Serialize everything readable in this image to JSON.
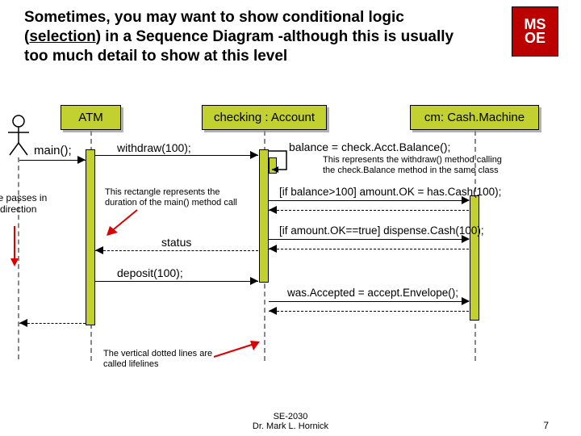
{
  "title_pre": "Sometimes, you may want to show conditional logic (",
  "title_underline": "selection",
  "title_post": ") in a Sequence Diagram -although this is usually too much detail to show at this level",
  "logo_top": "MS",
  "logo_mid": "OE",
  "objects": {
    "atm": "ATM",
    "checking": "checking : Account",
    "cm": "cm: Cash.Machine"
  },
  "actor_label": "main();",
  "messages": {
    "withdraw": "withdraw(100);",
    "balance": "balance = check.Acct.Balance();",
    "amountOK": "[if balance>100] amount.OK = has.Cash(100);",
    "dispense": "[if amount.OK==true] dispense.Cash(100);",
    "status": "status",
    "deposit": "deposit(100);",
    "wasAccepted": "was.Accepted = accept.Envelope();"
  },
  "notes": {
    "withdrawNote": "This represents the withdraw() method calling the check.Balance method in the same class",
    "rectNote": "This rectangle represents the duration of the main() method call",
    "lifelineNote": "The vertical dotted lines are called lifelines",
    "timeNote": "Time passes in this direction"
  },
  "footer": {
    "course": "SE-2030",
    "author": "Dr. Mark L. Hornick"
  },
  "page": "7"
}
